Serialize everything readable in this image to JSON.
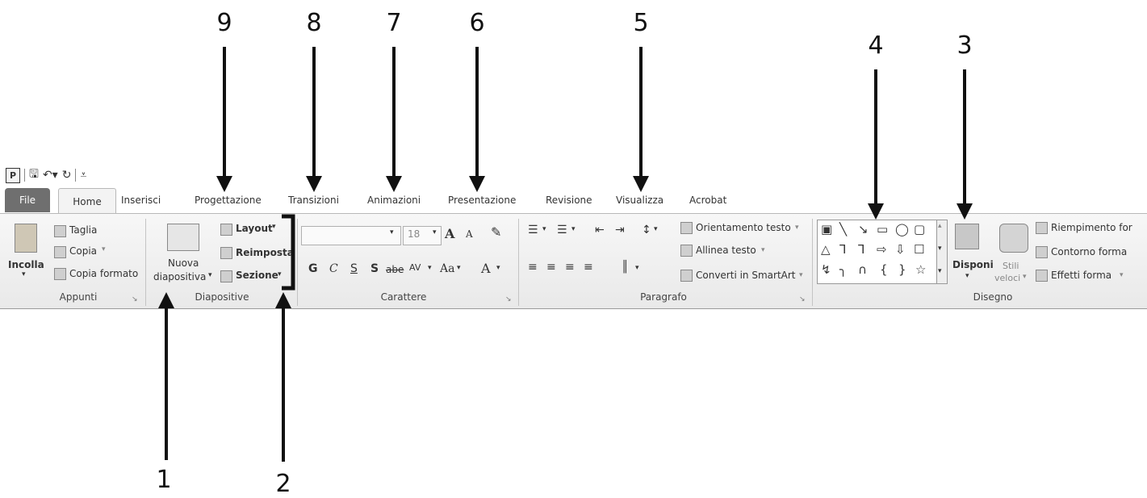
{
  "quick_access": {
    "logo": "P",
    "icons": [
      "save-icon",
      "undo-icon",
      "redo-icon",
      "customize-icon"
    ]
  },
  "tabs": [
    "File",
    "Home",
    "Inserisci",
    "Progettazione",
    "Transizioni",
    "Animazioni",
    "Presentazione",
    "Revisione",
    "Visualizza",
    "Acrobat"
  ],
  "appunti": {
    "paste": "Incolla",
    "cut": "Taglia",
    "copy": "Copia",
    "format_painter": "Copia formato",
    "label": "Appunti"
  },
  "diapositive": {
    "new_slide_1": "Nuova",
    "new_slide_2": "diapositiva",
    "layout": "Layout",
    "reset": "Reimposta",
    "section": "Sezione",
    "label": "Diapositive"
  },
  "carattere": {
    "size": "18",
    "bold": "G",
    "italic": "C",
    "underline": "S",
    "shadow": "S",
    "strike": "abe",
    "spacing": "AV",
    "case": "Aa",
    "color": "A",
    "grow": "A",
    "shrink": "A",
    "label": "Carattere"
  },
  "paragrafo": {
    "text_direction": "Orientamento testo",
    "align_text": "Allinea testo",
    "smartart": "Converti in SmartArt",
    "label": "Paragrafo"
  },
  "disegno": {
    "arrange": "Disponi",
    "quick_styles_1": "Stili",
    "quick_styles_2": "veloci",
    "fill": "Riempimento for",
    "outline": "Contorno forma",
    "effects": "Effetti forma",
    "label": "Disegno"
  },
  "shape_glyphs": [
    "▣",
    "╲",
    "↘",
    "▭",
    "◯",
    "▢",
    "△",
    "⅂",
    "⅂",
    "⇨",
    "⇩",
    "☐",
    "↯",
    "╮",
    "∩",
    "{",
    "}",
    "☆"
  ],
  "callouts": [
    "9",
    "8",
    "7",
    "6",
    "5",
    "4",
    "3",
    "1",
    "2"
  ],
  "accent_color": "#6f6f6f"
}
